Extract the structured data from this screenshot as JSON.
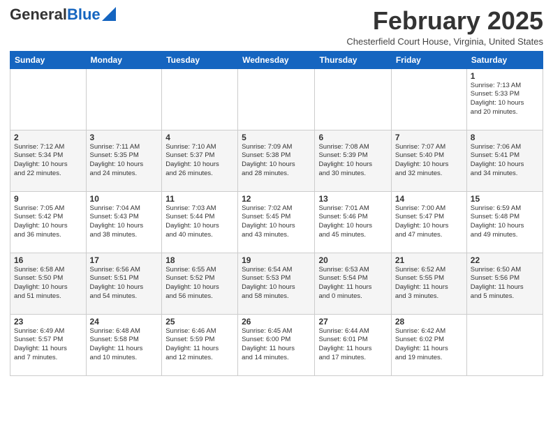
{
  "header": {
    "logo_general": "General",
    "logo_blue": "Blue",
    "month_title": "February 2025",
    "subtitle": "Chesterfield Court House, Virginia, United States"
  },
  "weekdays": [
    "Sunday",
    "Monday",
    "Tuesday",
    "Wednesday",
    "Thursday",
    "Friday",
    "Saturday"
  ],
  "weeks": [
    [
      {
        "day": "",
        "info": ""
      },
      {
        "day": "",
        "info": ""
      },
      {
        "day": "",
        "info": ""
      },
      {
        "day": "",
        "info": ""
      },
      {
        "day": "",
        "info": ""
      },
      {
        "day": "",
        "info": ""
      },
      {
        "day": "1",
        "info": "Sunrise: 7:13 AM\nSunset: 5:33 PM\nDaylight: 10 hours\nand 20 minutes."
      }
    ],
    [
      {
        "day": "2",
        "info": "Sunrise: 7:12 AM\nSunset: 5:34 PM\nDaylight: 10 hours\nand 22 minutes."
      },
      {
        "day": "3",
        "info": "Sunrise: 7:11 AM\nSunset: 5:35 PM\nDaylight: 10 hours\nand 24 minutes."
      },
      {
        "day": "4",
        "info": "Sunrise: 7:10 AM\nSunset: 5:37 PM\nDaylight: 10 hours\nand 26 minutes."
      },
      {
        "day": "5",
        "info": "Sunrise: 7:09 AM\nSunset: 5:38 PM\nDaylight: 10 hours\nand 28 minutes."
      },
      {
        "day": "6",
        "info": "Sunrise: 7:08 AM\nSunset: 5:39 PM\nDaylight: 10 hours\nand 30 minutes."
      },
      {
        "day": "7",
        "info": "Sunrise: 7:07 AM\nSunset: 5:40 PM\nDaylight: 10 hours\nand 32 minutes."
      },
      {
        "day": "8",
        "info": "Sunrise: 7:06 AM\nSunset: 5:41 PM\nDaylight: 10 hours\nand 34 minutes."
      }
    ],
    [
      {
        "day": "9",
        "info": "Sunrise: 7:05 AM\nSunset: 5:42 PM\nDaylight: 10 hours\nand 36 minutes."
      },
      {
        "day": "10",
        "info": "Sunrise: 7:04 AM\nSunset: 5:43 PM\nDaylight: 10 hours\nand 38 minutes."
      },
      {
        "day": "11",
        "info": "Sunrise: 7:03 AM\nSunset: 5:44 PM\nDaylight: 10 hours\nand 40 minutes."
      },
      {
        "day": "12",
        "info": "Sunrise: 7:02 AM\nSunset: 5:45 PM\nDaylight: 10 hours\nand 43 minutes."
      },
      {
        "day": "13",
        "info": "Sunrise: 7:01 AM\nSunset: 5:46 PM\nDaylight: 10 hours\nand 45 minutes."
      },
      {
        "day": "14",
        "info": "Sunrise: 7:00 AM\nSunset: 5:47 PM\nDaylight: 10 hours\nand 47 minutes."
      },
      {
        "day": "15",
        "info": "Sunrise: 6:59 AM\nSunset: 5:48 PM\nDaylight: 10 hours\nand 49 minutes."
      }
    ],
    [
      {
        "day": "16",
        "info": "Sunrise: 6:58 AM\nSunset: 5:50 PM\nDaylight: 10 hours\nand 51 minutes."
      },
      {
        "day": "17",
        "info": "Sunrise: 6:56 AM\nSunset: 5:51 PM\nDaylight: 10 hours\nand 54 minutes."
      },
      {
        "day": "18",
        "info": "Sunrise: 6:55 AM\nSunset: 5:52 PM\nDaylight: 10 hours\nand 56 minutes."
      },
      {
        "day": "19",
        "info": "Sunrise: 6:54 AM\nSunset: 5:53 PM\nDaylight: 10 hours\nand 58 minutes."
      },
      {
        "day": "20",
        "info": "Sunrise: 6:53 AM\nSunset: 5:54 PM\nDaylight: 11 hours\nand 0 minutes."
      },
      {
        "day": "21",
        "info": "Sunrise: 6:52 AM\nSunset: 5:55 PM\nDaylight: 11 hours\nand 3 minutes."
      },
      {
        "day": "22",
        "info": "Sunrise: 6:50 AM\nSunset: 5:56 PM\nDaylight: 11 hours\nand 5 minutes."
      }
    ],
    [
      {
        "day": "23",
        "info": "Sunrise: 6:49 AM\nSunset: 5:57 PM\nDaylight: 11 hours\nand 7 minutes."
      },
      {
        "day": "24",
        "info": "Sunrise: 6:48 AM\nSunset: 5:58 PM\nDaylight: 11 hours\nand 10 minutes."
      },
      {
        "day": "25",
        "info": "Sunrise: 6:46 AM\nSunset: 5:59 PM\nDaylight: 11 hours\nand 12 minutes."
      },
      {
        "day": "26",
        "info": "Sunrise: 6:45 AM\nSunset: 6:00 PM\nDaylight: 11 hours\nand 14 minutes."
      },
      {
        "day": "27",
        "info": "Sunrise: 6:44 AM\nSunset: 6:01 PM\nDaylight: 11 hours\nand 17 minutes."
      },
      {
        "day": "28",
        "info": "Sunrise: 6:42 AM\nSunset: 6:02 PM\nDaylight: 11 hours\nand 19 minutes."
      },
      {
        "day": "",
        "info": ""
      }
    ]
  ]
}
